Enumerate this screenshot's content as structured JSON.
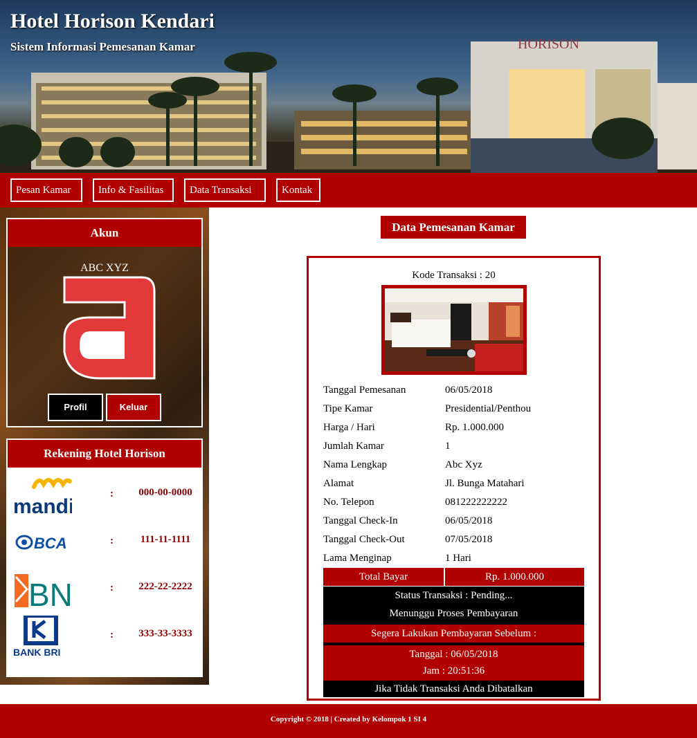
{
  "header": {
    "title": "Hotel Horison Kendari",
    "subtitle": "Sistem Informasi Pemesanan Kamar",
    "building_sign": "HORISON"
  },
  "nav": {
    "items": [
      {
        "label": "Pesan Kamar"
      },
      {
        "label": "Info & Fasilitas"
      },
      {
        "label": "Data Transaksi"
      },
      {
        "label": "Kontak"
      }
    ]
  },
  "sidebar": {
    "akun": {
      "title": "Akun",
      "user_name": "ABC XYZ",
      "profil_label": "Profil",
      "keluar_label": "Keluar"
    },
    "rekening": {
      "title": "Rekening Hotel Horison",
      "banks": [
        {
          "name": "mandiri",
          "colon": ":",
          "account": "000-00-0000"
        },
        {
          "name": "BCA",
          "colon": ":",
          "account": "111-11-1111"
        },
        {
          "name": "BNI",
          "colon": ":",
          "account": "222-22-2222"
        },
        {
          "name": "BANK BRI",
          "colon": ":",
          "account": "333-33-3333"
        }
      ]
    }
  },
  "main": {
    "title": "Data Pemesanan Kamar",
    "kode_transaksi": "Kode Transaksi : 20",
    "details": [
      {
        "label": "Tanggal Pemesanan",
        "value": "06/05/2018"
      },
      {
        "label": "Tipe Kamar",
        "value": "Presidential/Penthou"
      },
      {
        "label": "Harga / Hari",
        "value": "Rp. 1.000.000"
      },
      {
        "label": "Jumlah Kamar",
        "value": "1"
      },
      {
        "label": "Nama Lengkap",
        "value": "Abc Xyz"
      },
      {
        "label": "Alamat",
        "value": "Jl. Bunga Matahari"
      },
      {
        "label": "No. Telepon",
        "value": "081222222222"
      },
      {
        "label": "Tanggal Check-In",
        "value": "06/05/2018"
      },
      {
        "label": "Tanggal Check-Out",
        "value": "07/05/2018"
      },
      {
        "label": "Lama Menginap",
        "value": "1 Hari"
      }
    ],
    "total_label": "Total Bayar",
    "total_value": "Rp. 1.000.000",
    "status_line": "Status Transaksi : Pending...",
    "status_sub": "Menunggu Proses Pembayaran",
    "deadline_heading": "Segera Lakukan Pembayaran Sebelum :",
    "deadline_date": "Tanggal : 06/05/2018",
    "deadline_time": "Jam : 20:51:36",
    "warning": "Jika Tidak Transaksi Anda Dibatalkan"
  },
  "footer": {
    "text": "Copyright © 2018 | Created by Kelompok 1 SI 4"
  },
  "colors": {
    "primary_red": "#b00000",
    "dark_red_text": "#8b0000",
    "black": "#000000",
    "white": "#ffffff"
  }
}
